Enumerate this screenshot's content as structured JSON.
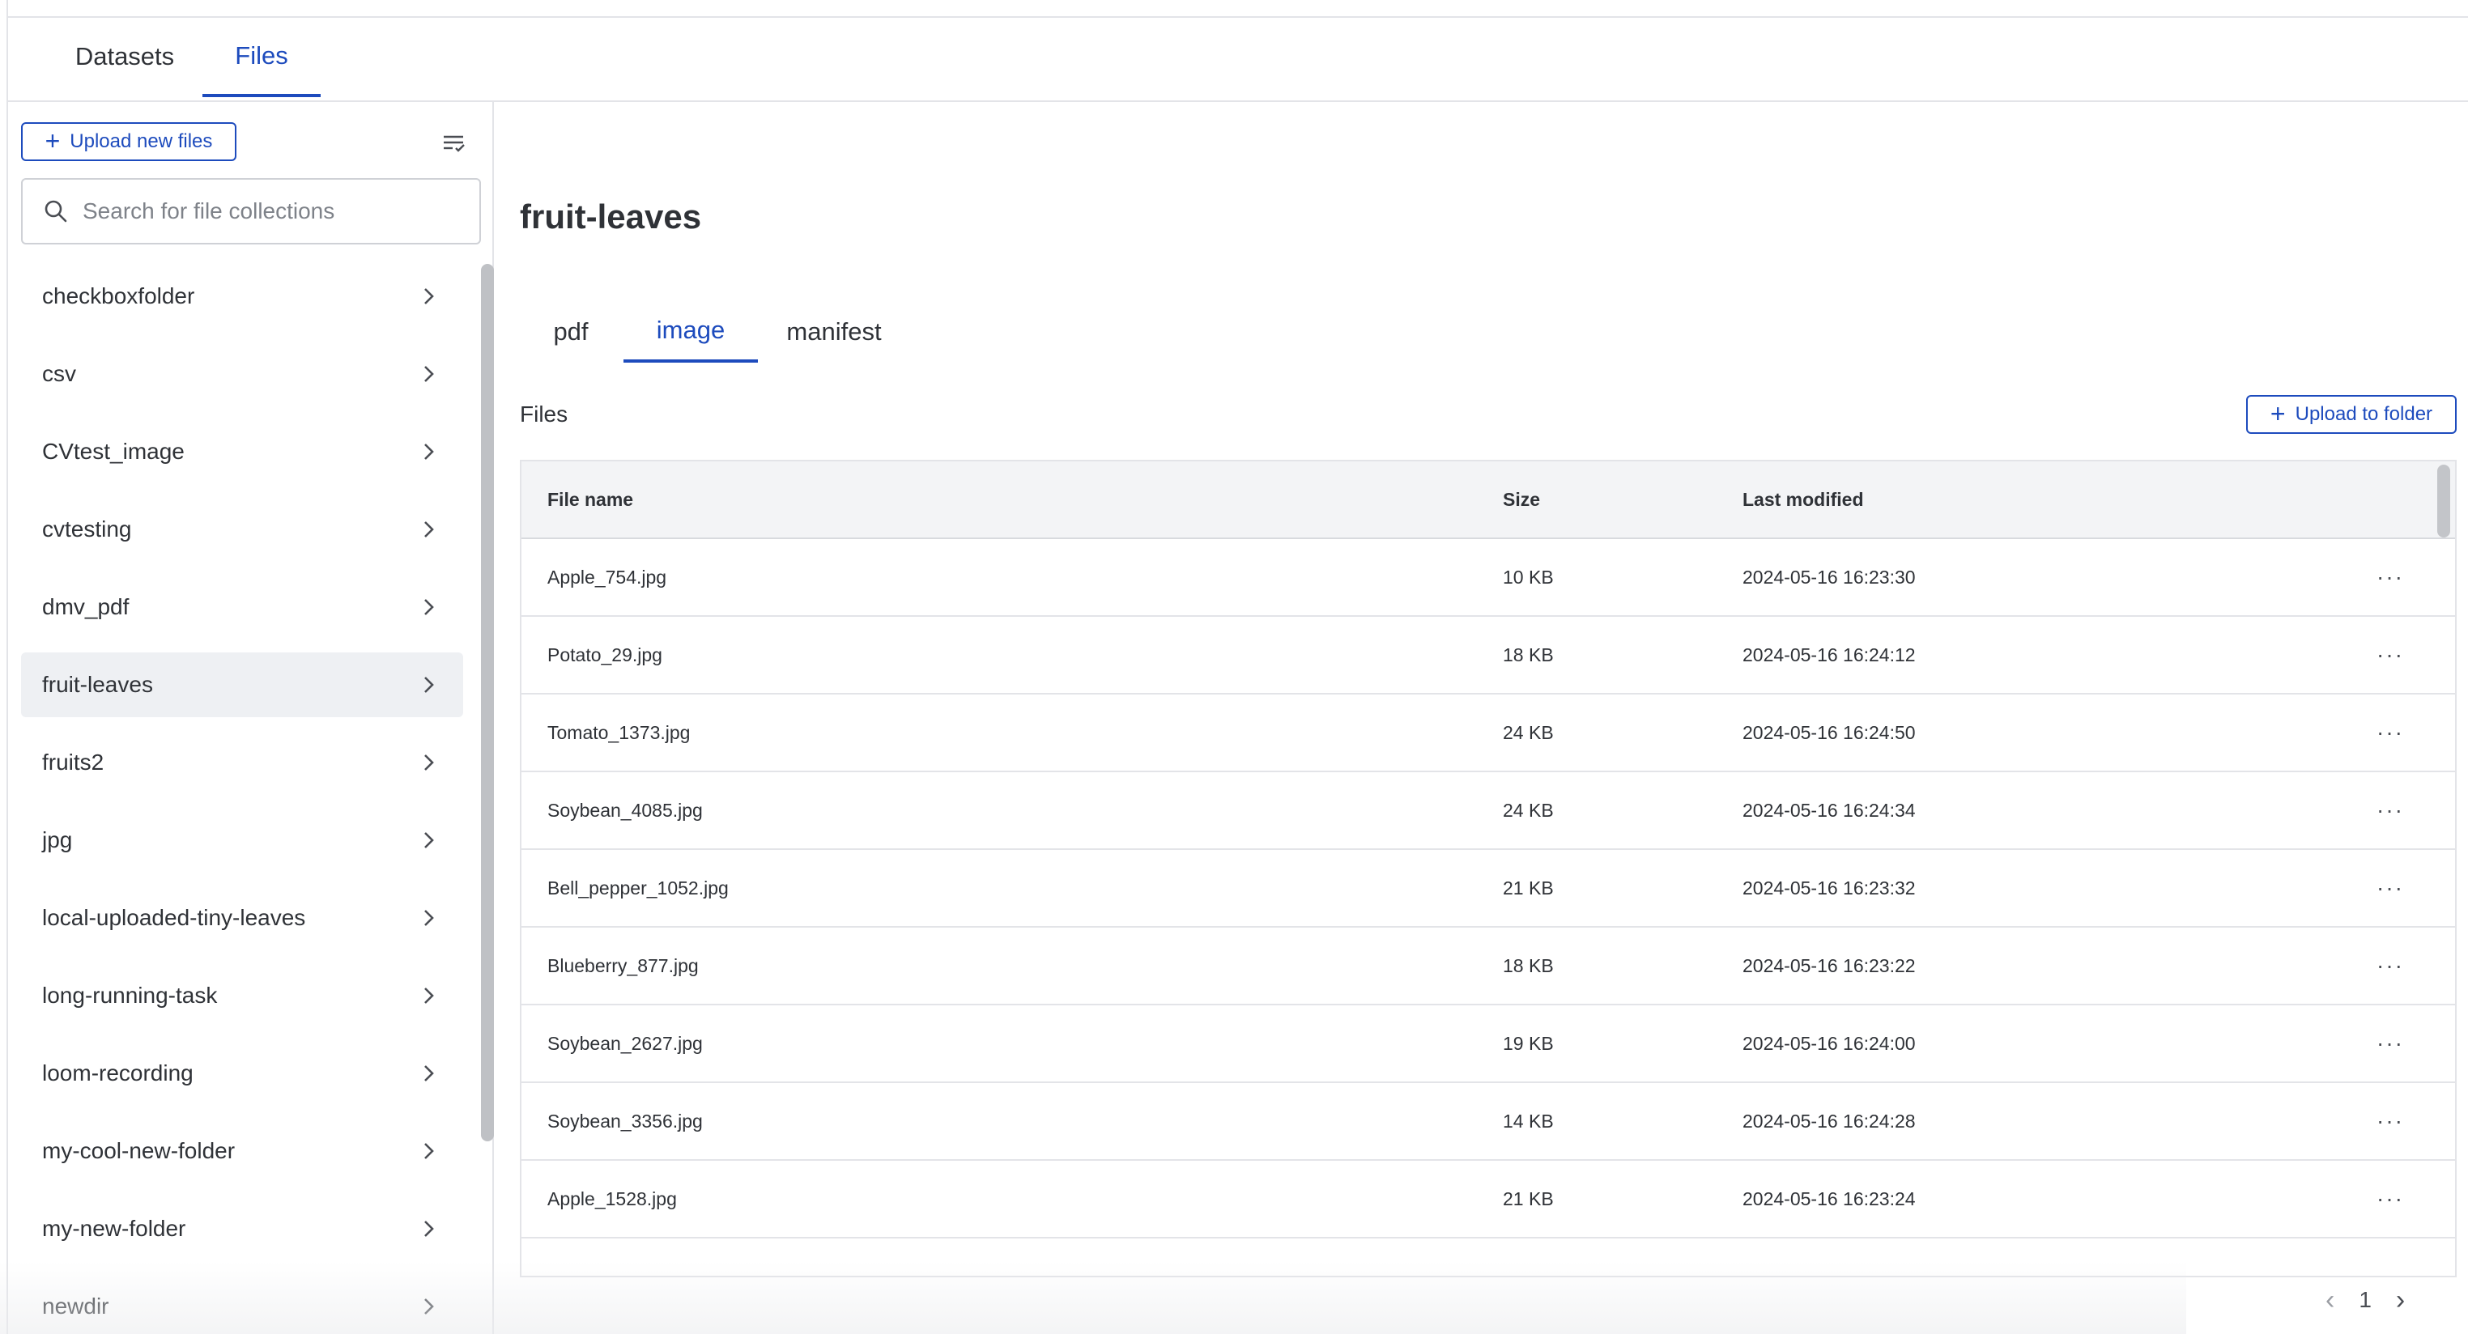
{
  "top_tabs": [
    {
      "label": "Datasets",
      "active": false
    },
    {
      "label": "Files",
      "active": true
    }
  ],
  "sidebar": {
    "upload_label": "Upload new files",
    "search_placeholder": "Search for file collections",
    "folders": [
      "checkboxfolder",
      "csv",
      "CVtest_image",
      "cvtesting",
      "dmv_pdf",
      "fruit-leaves",
      "fruits2",
      "jpg",
      "local-uploaded-tiny-leaves",
      "long-running-task",
      "loom-recording",
      "my-cool-new-folder",
      "my-new-folder",
      "newdir"
    ],
    "selected_folder": "fruit-leaves"
  },
  "main": {
    "title": "fruit-leaves",
    "sub_tabs": [
      {
        "label": "pdf",
        "active": false
      },
      {
        "label": "image",
        "active": true
      },
      {
        "label": "manifest",
        "active": false
      }
    ],
    "files_label": "Files",
    "upload_folder_label": "Upload to folder",
    "table": {
      "columns": [
        "File name",
        "Size",
        "Last modified"
      ],
      "rows": [
        {
          "name": "Apple_754.jpg",
          "size": "10 KB",
          "modified": "2024-05-16 16:23:30"
        },
        {
          "name": "Potato_29.jpg",
          "size": "18 KB",
          "modified": "2024-05-16 16:24:12"
        },
        {
          "name": "Tomato_1373.jpg",
          "size": "24 KB",
          "modified": "2024-05-16 16:24:50"
        },
        {
          "name": "Soybean_4085.jpg",
          "size": "24 KB",
          "modified": "2024-05-16 16:24:34"
        },
        {
          "name": "Bell_pepper_1052.jpg",
          "size": "21 KB",
          "modified": "2024-05-16 16:23:32"
        },
        {
          "name": "Blueberry_877.jpg",
          "size": "18 KB",
          "modified": "2024-05-16 16:23:22"
        },
        {
          "name": "Soybean_2627.jpg",
          "size": "19 KB",
          "modified": "2024-05-16 16:24:00"
        },
        {
          "name": "Soybean_3356.jpg",
          "size": "14 KB",
          "modified": "2024-05-16 16:24:28"
        },
        {
          "name": "Apple_1528.jpg",
          "size": "21 KB",
          "modified": "2024-05-16 16:23:24"
        }
      ],
      "row_action_icon": "more-horizontal-icon"
    },
    "pagination": {
      "current_page": "1"
    }
  },
  "colors": {
    "accent": "#1d4bbd",
    "selected_bg": "#eef0f3",
    "header_bg": "#f3f4f6",
    "border": "#e3e4e8"
  }
}
